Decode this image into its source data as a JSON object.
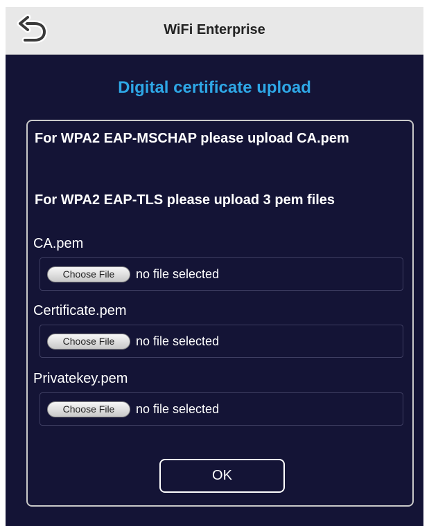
{
  "header": {
    "title": "WiFi Enterprise",
    "back_icon": "back-arrow-icon"
  },
  "main": {
    "title": "Digital certificate upload",
    "notes": [
      "For WPA2 EAP-MSCHAP please upload CA.pem",
      "For WPA2 EAP-TLS please upload 3 pem files"
    ],
    "files": [
      {
        "label": "CA.pem",
        "button": "Choose File",
        "status": "no file selected"
      },
      {
        "label": "Certificate.pem",
        "button": "Choose File",
        "status": "no file selected"
      },
      {
        "label": "Privatekey.pem",
        "button": "Choose File",
        "status": "no file selected"
      }
    ],
    "ok_label": "OK"
  },
  "colors": {
    "background": "#141436",
    "title_accent": "#2ea7e6",
    "header_bg": "#e8e8e8"
  }
}
